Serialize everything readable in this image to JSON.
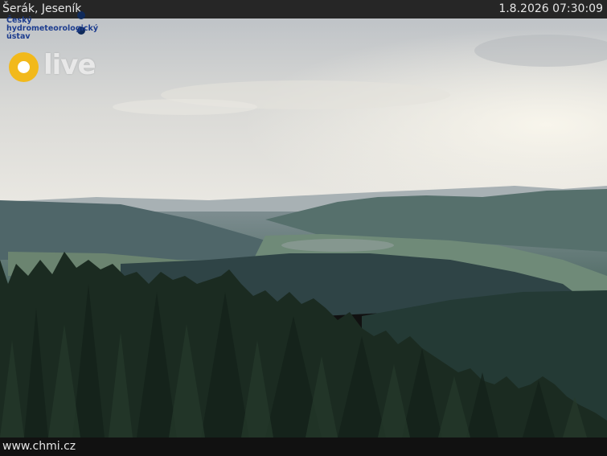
{
  "caption": {
    "location": "Šerák, Jeseník",
    "timestamp": "1.8.2026 07:30:09"
  },
  "logo": {
    "org_line1": "Český",
    "org_line2": "hydrometeorologický",
    "org_line3": "ústav"
  },
  "live_badge": {
    "label": "live",
    "accent": "#f2b91b"
  },
  "footer": {
    "site": "www.chmi.cz"
  },
  "colors": {
    "sky_top": "#c7cacd",
    "sky_bottom": "#e9e7e0",
    "forest": "#1b2b21",
    "valley": "#3f5a58"
  }
}
